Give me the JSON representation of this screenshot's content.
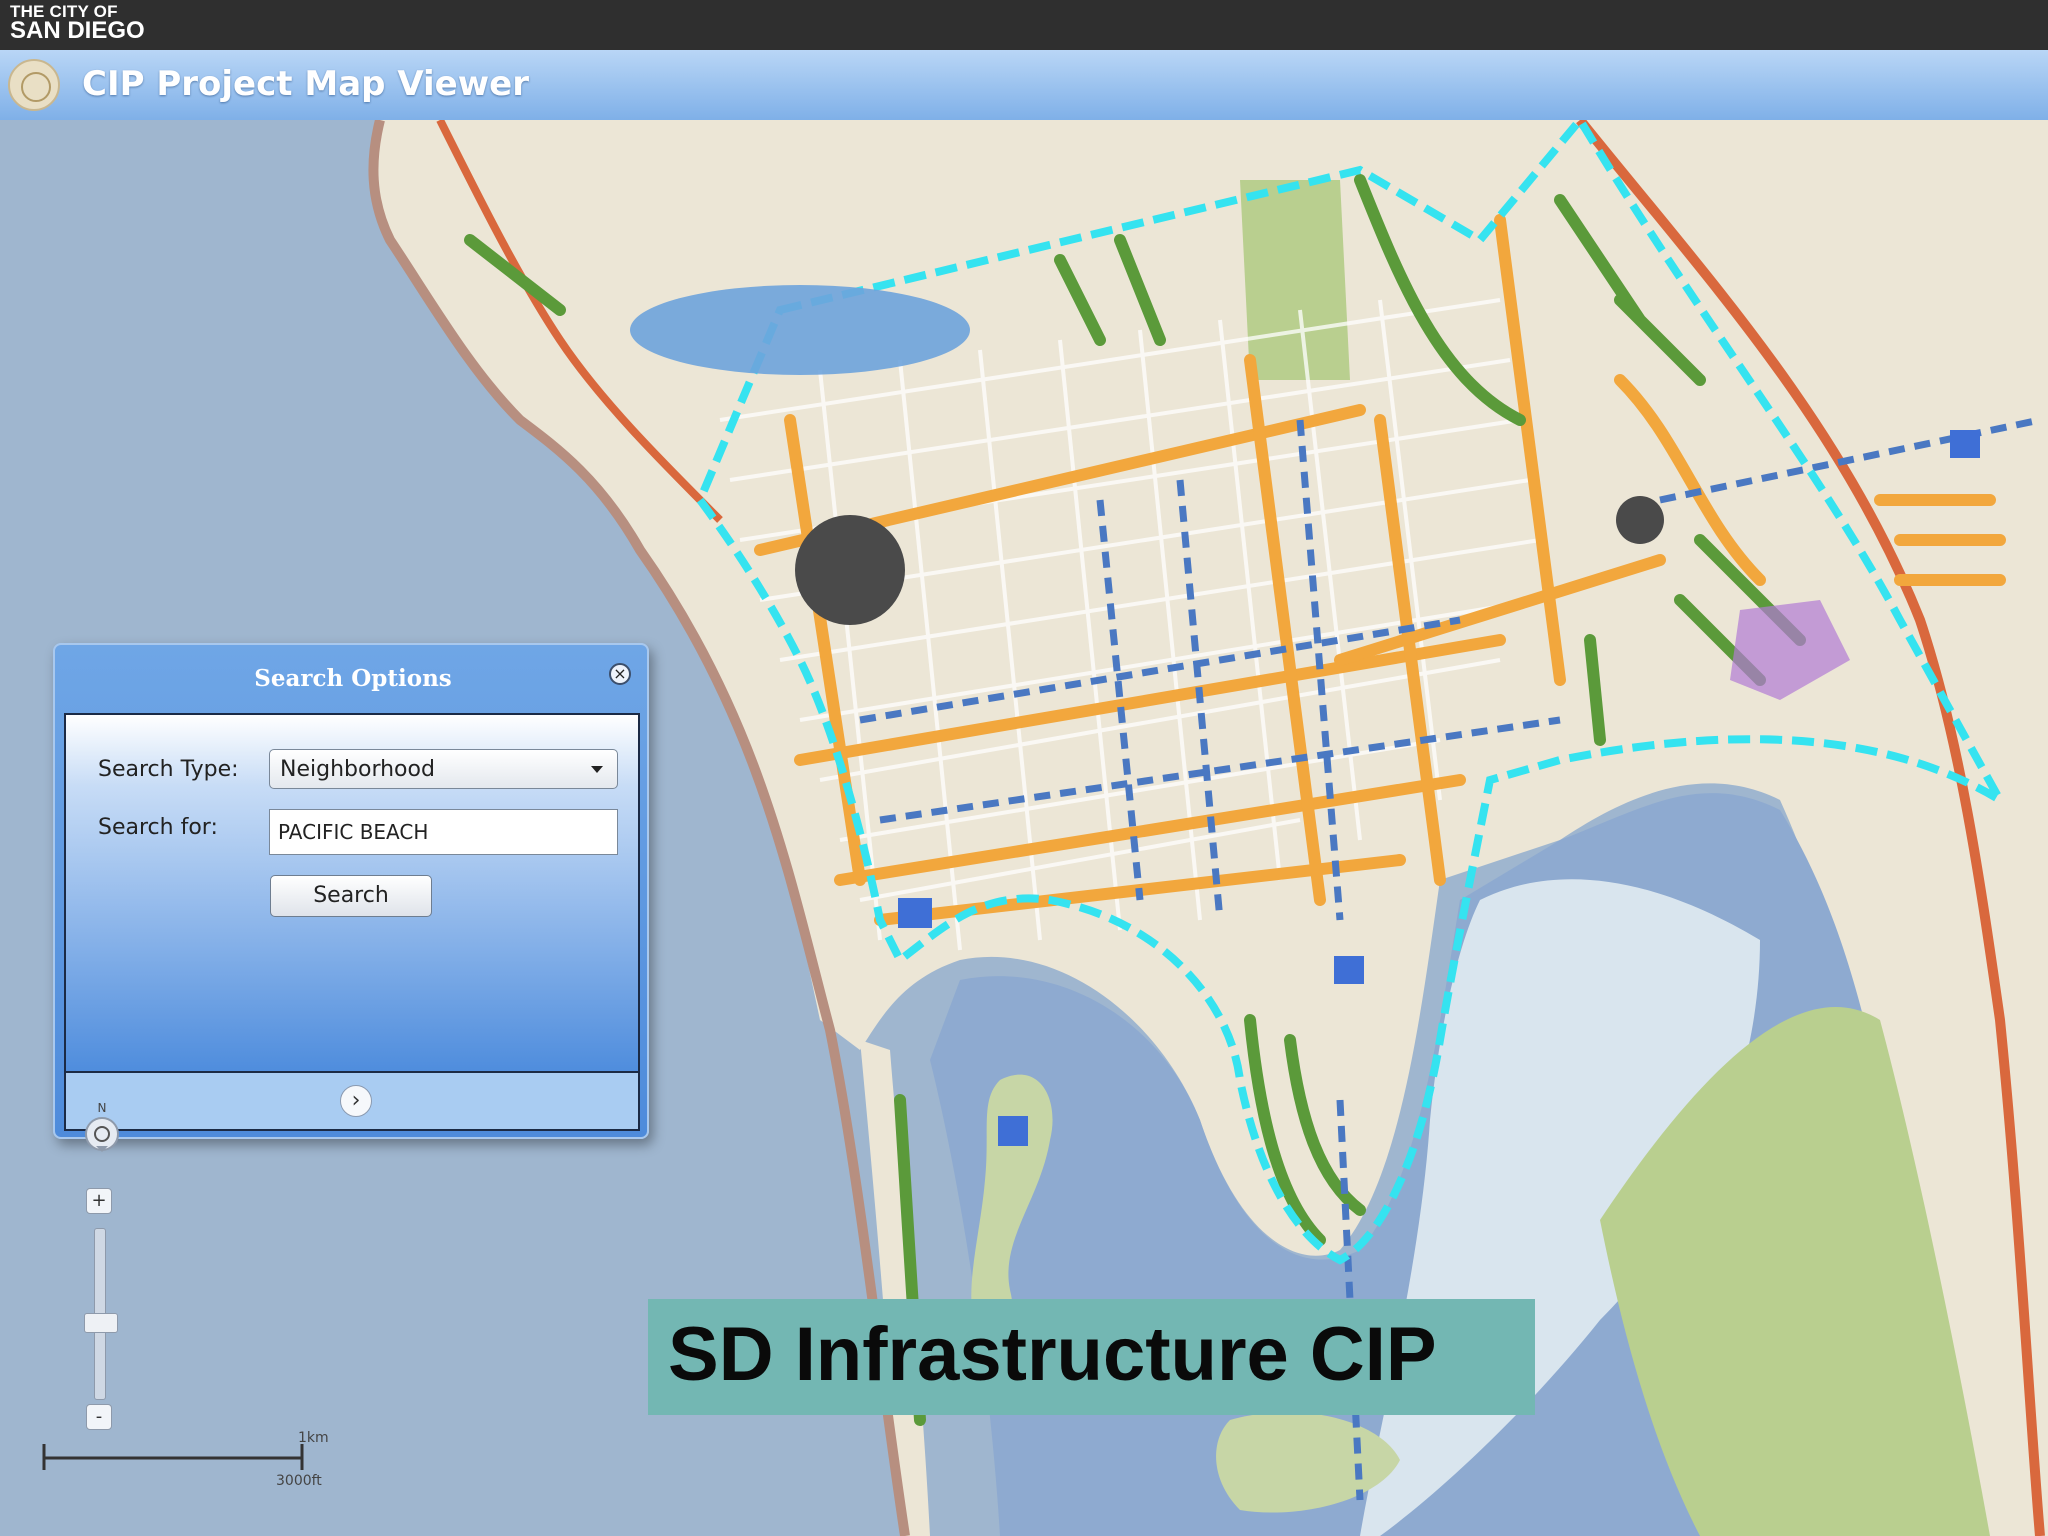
{
  "header": {
    "city_line1": "THE CITY OF",
    "city_line2": "SAN DIEGO",
    "app_title": "CIP Project Map Viewer",
    "icons": [
      "city-seal-icon"
    ]
  },
  "search_panel": {
    "title": "Search Options",
    "search_type_label": "Search Type:",
    "search_type_value": "Neighborhood",
    "search_for_label": "Search for:",
    "search_for_value": "PACIFIC BEACH",
    "search_button": "Search",
    "icons": [
      "close-icon",
      "chevron-right-icon"
    ]
  },
  "map_controls": {
    "compass_letter": "N",
    "zoom_in": "+",
    "zoom_out": "-",
    "icons": [
      "compass-icon",
      "zoom-in-icon",
      "zoom-out-icon"
    ]
  },
  "scale_bar": {
    "metric": "1km",
    "imperial": "3000ft"
  },
  "banner": {
    "text": "SD Infrastructure CIP"
  },
  "colors": {
    "header_bg": "#2f2f2f",
    "title_bar": "#9cc4f0",
    "water": "#9fb6cf",
    "land": "#ece6d6",
    "road_orange": "#f2a73d",
    "park_green": "#5b9a3a",
    "project_blue": "#4a78c2",
    "boundary_cyan": "#35e3f0",
    "banner_bg": "#73b7b3"
  }
}
